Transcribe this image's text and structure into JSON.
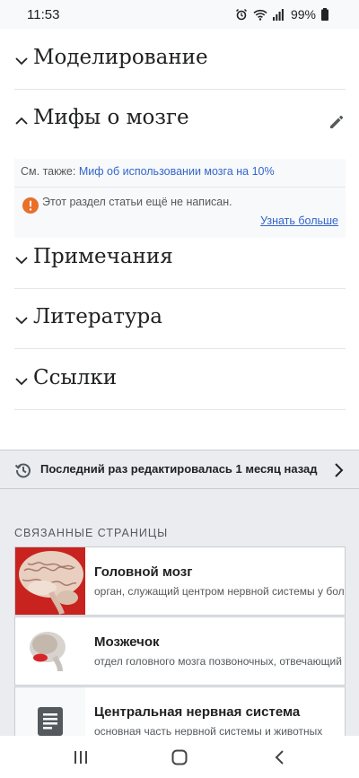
{
  "status_bar": {
    "time": "11:53",
    "battery": "99%"
  },
  "sections": {
    "modeling": "Моделирование",
    "myths": "Мифы о мозге",
    "notes": "Примечания",
    "literature": "Литература",
    "links": "Ссылки"
  },
  "myths_box": {
    "see_also_label": "См. также:",
    "see_also_link": "Миф об использовании мозга на 10%",
    "notice": "Этот раздел статьи ещё не написан.",
    "learn_more": "Узнать больше"
  },
  "last_edited": "Последний раз редактировалась 1 месяц назад",
  "related": {
    "heading": "СВЯЗАННЫЕ СТРАНИЦЫ",
    "items": [
      {
        "title": "Головной мозг",
        "description": "орган, служащий центром нервной системы у большинства"
      },
      {
        "title": "Мозжечок",
        "description": "отдел головного мозга позвоночных, отвечающий за"
      },
      {
        "title": "Центральная нервная система",
        "description": "основная часть нервной системы и животных"
      }
    ]
  },
  "colors": {
    "link": "#3366cc",
    "warning": "#fc3",
    "notice_icon": "#e8702a"
  }
}
